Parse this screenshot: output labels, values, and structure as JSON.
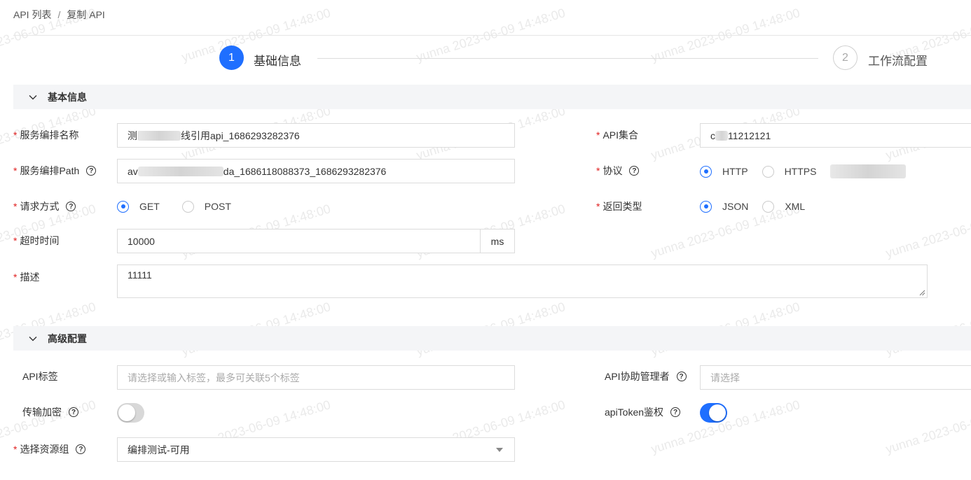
{
  "breadcrumb": {
    "root": "API 列表",
    "separator": "/",
    "current": "复制 API"
  },
  "steps": [
    {
      "num": "1",
      "label": "基础信息",
      "active": true
    },
    {
      "num": "2",
      "label": "工作流配置",
      "active": false
    }
  ],
  "sections": {
    "basic": "基本信息",
    "advanced": "高级配置"
  },
  "form": {
    "service_name": {
      "label": "服务编排名称",
      "value_prefix": "测",
      "value_suffix": "线引用api_1686293282376"
    },
    "service_path": {
      "label": "服务编排Path",
      "value_prefix": "av",
      "value_suffix": "da_1686118088373_1686293282376"
    },
    "request_method": {
      "label": "请求方式",
      "options": [
        "GET",
        "POST"
      ],
      "selected": "GET"
    },
    "timeout": {
      "label": "超时时间",
      "value": "10000",
      "unit": "ms"
    },
    "description": {
      "label": "描述",
      "value": "11111"
    },
    "api_collection": {
      "label": "API集合",
      "value_prefix": "c",
      "value_suffix": "11212121"
    },
    "protocol": {
      "label": "协议",
      "options": [
        "HTTP",
        "HTTPS"
      ],
      "selected": "HTTP"
    },
    "return_type": {
      "label": "返回类型",
      "options": [
        "JSON",
        "XML"
      ],
      "selected": "JSON"
    },
    "api_tags": {
      "label": "API标签",
      "placeholder": "请选择或输入标签，最多可关联5个标签"
    },
    "co_managers": {
      "label": "API协助管理者",
      "placeholder": "请选择"
    },
    "transport_encryption": {
      "label": "传输加密",
      "enabled": false
    },
    "api_token_auth": {
      "label": "apiToken鉴权",
      "enabled": true
    },
    "resource_group": {
      "label": "选择资源组",
      "value": "编排测试-可用"
    }
  },
  "watermark": "yunna 2023-06-09 14:48:00",
  "colors": {
    "primary": "#1f6fff",
    "required": "#e02020"
  }
}
